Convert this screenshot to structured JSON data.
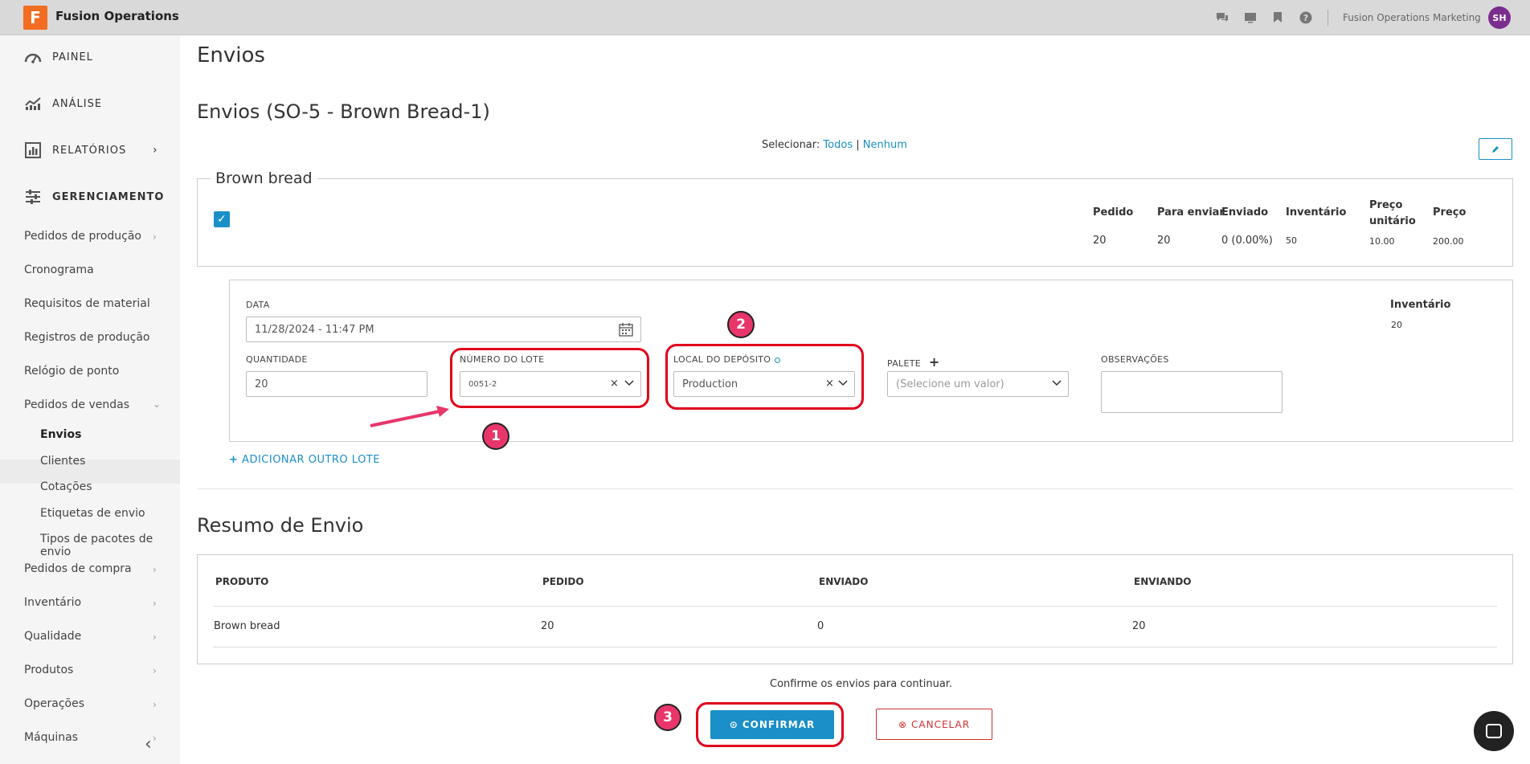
{
  "app": {
    "logo_letter": "F",
    "title": "Fusion Operations",
    "org": "Fusion Operations Marketing",
    "avatar": "SH",
    "icons": [
      "chat-icon",
      "screen-icon",
      "bookmark-icon",
      "help-icon"
    ]
  },
  "sidebar": {
    "top": [
      {
        "label": "PAINEL",
        "icon": "dashboard-icon"
      },
      {
        "label": "ANÁLISE",
        "icon": "analytics-icon"
      },
      {
        "label": "RELATÓRIOS",
        "icon": "reports-icon"
      },
      {
        "label": "GERENCIAMENTO",
        "icon": "sliders-icon"
      }
    ],
    "items": [
      {
        "label": "Pedidos de produção"
      },
      {
        "label": "Cronograma"
      },
      {
        "label": "Requisitos de material"
      },
      {
        "label": "Registros de produção"
      },
      {
        "label": "Relógio de ponto"
      },
      {
        "label": "Pedidos de vendas"
      }
    ],
    "sub_items": [
      {
        "label": "Envios"
      },
      {
        "label": "Clientes"
      },
      {
        "label": "Cotações"
      },
      {
        "label": "Etiquetas de envio"
      },
      {
        "label": "Tipos de pacotes de envio"
      }
    ],
    "bottom_items": [
      {
        "label": "Pedidos de compra"
      },
      {
        "label": "Inventário"
      },
      {
        "label": "Qualidade"
      },
      {
        "label": "Produtos"
      },
      {
        "label": "Operações"
      },
      {
        "label": "Máquinas"
      }
    ]
  },
  "main": {
    "page_title": "Envios",
    "section_title": "Envios (SO-5 - Brown Bread-1)",
    "select_label": "Selecionar:",
    "select_all": "Todos",
    "select_sep": "|",
    "select_none": "Nenhum",
    "product": {
      "name": "Brown bread",
      "headers": {
        "pedido": "Pedido",
        "para_enviar": "Para enviar",
        "enviado": "Enviado",
        "inventario": "Inventário",
        "preco_unit_1": "Preço",
        "preco_unit_2": "unitário",
        "preco": "Preço"
      },
      "values": {
        "pedido": "20",
        "para_enviar": "20",
        "enviado": "0 (0.00%)",
        "inventario": "50",
        "preco_unit": "10.00",
        "preco": "200.00"
      }
    },
    "lot": {
      "date_label": "DATA",
      "date_value": "11/28/2024 - 11:47 PM",
      "qty_label": "QUANTIDADE",
      "qty_value": "20",
      "lot_label": "NÚMERO DO LOTE",
      "lot_value": "0051-2",
      "warehouse_label": "LOCAL DO DEPÓSITO",
      "warehouse_value": "Production",
      "pallet_label": "PALETE",
      "pallet_placeholder": "(Selecione um valor)",
      "notes_label": "OBSERVAÇÕES",
      "inventory_label": "Inventário",
      "inventory_value": "20"
    },
    "add_lot": "ADICIONAR OUTRO LOTE",
    "annotations": [
      "1",
      "2",
      "3"
    ]
  },
  "summary": {
    "title": "Resumo de Envio",
    "headers": [
      "PRODUTO",
      "PEDIDO",
      "ENVIADO",
      "ENVIANDO"
    ],
    "row": [
      "Brown bread",
      "20",
      "0",
      "20"
    ]
  },
  "actions": {
    "confirm_msg": "Confirme os envios para continuar.",
    "confirm": "CONFIRMAR",
    "cancel": "CANCELAR"
  }
}
